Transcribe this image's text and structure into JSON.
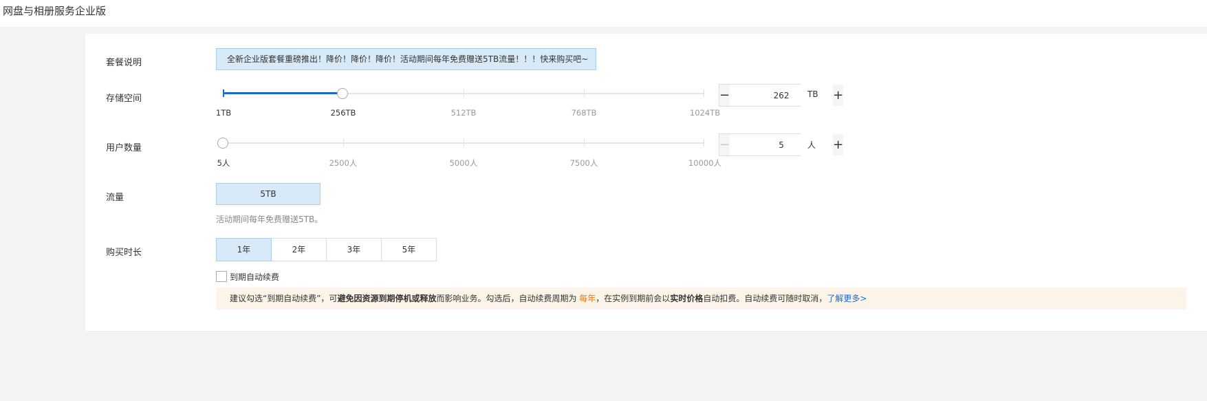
{
  "page": {
    "title": "网盘与相册服务企业版"
  },
  "package": {
    "label": "套餐说明",
    "notice": "全新企业版套餐重磅推出！降价！降价！降价！活动期间每年免费赠送5TB流量！！！快来购买吧~"
  },
  "storage": {
    "label": "存储空间",
    "marks": [
      "1TB",
      "256TB",
      "512TB",
      "768TB",
      "1024TB"
    ],
    "min": 1,
    "max": 1024,
    "slider_value": 256,
    "value": "262",
    "unit": "TB",
    "minus_icon": "minus-icon",
    "plus_icon": "plus-icon"
  },
  "users": {
    "label": "用户数量",
    "marks": [
      "5人",
      "2500人",
      "5000人",
      "7500人",
      "10000人"
    ],
    "min": 5,
    "max": 10000,
    "slider_value": 5,
    "value": "5",
    "unit": "人",
    "minus_icon": "minus-icon",
    "plus_icon": "plus-icon"
  },
  "flow": {
    "label": "流量",
    "option": "5TB",
    "hint": "活动期间每年免费赠送5TB。"
  },
  "duration": {
    "label": "购买时长",
    "options": [
      "1年",
      "2年",
      "3年",
      "5年"
    ],
    "selected": "1年"
  },
  "auto_renew": {
    "label": "到期自动续费",
    "checked": false
  },
  "tip": {
    "part1": "建议勾选“到期自动续费”，可",
    "bold1": "避免因资源到期停机或释放",
    "part2": "而影响业务。勾选后，自动续费周期为 ",
    "highlight": "每年",
    "part3": "，在实例到期前会以",
    "bold2": "实时价格",
    "part4": "自动扣费。自动续费可随时取消，",
    "link": "了解更多>"
  },
  "colors": {
    "accent": "#1a6bd1",
    "selected_bg": "#d8eaf7",
    "selected_border": "#a9cde8",
    "tip_bg": "#fdf4e9",
    "highlight": "#ff7200"
  }
}
